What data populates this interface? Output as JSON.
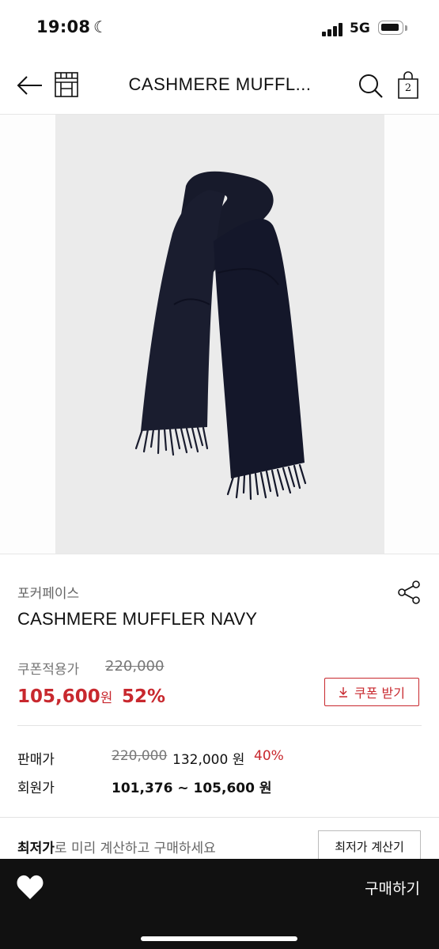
{
  "status_bar": {
    "time": "19:08",
    "network": "5G"
  },
  "header": {
    "title": "CASHMERE MUFFL...",
    "cart_count": "2"
  },
  "product": {
    "brand": "포커페이스",
    "name": "CASHMERE MUFFLER NAVY",
    "coupon_label": "쿠폰적용가",
    "coupon_original": "220,000",
    "coupon_price": "105,600",
    "coupon_unit": "원",
    "coupon_rate": "52%",
    "coupon_button": "쿠폰 받기",
    "sale_label": "판매가",
    "sale_original": "220,000",
    "sale_price": "132,000 원",
    "sale_rate": "40%",
    "member_label": "회원가",
    "member_price": "101,376 ~ 105,600 원",
    "lowest_strong": "최저가",
    "lowest_rest": "로 미리 계산하고 구매하세요",
    "lowest_button": "최저가 계산기"
  },
  "bottom_bar": {
    "buy_label": "구매하기"
  },
  "colors": {
    "accent": "#c8282e",
    "bar": "#111111",
    "image_bg": "#ebebeb",
    "scarf": "#171a2b"
  }
}
